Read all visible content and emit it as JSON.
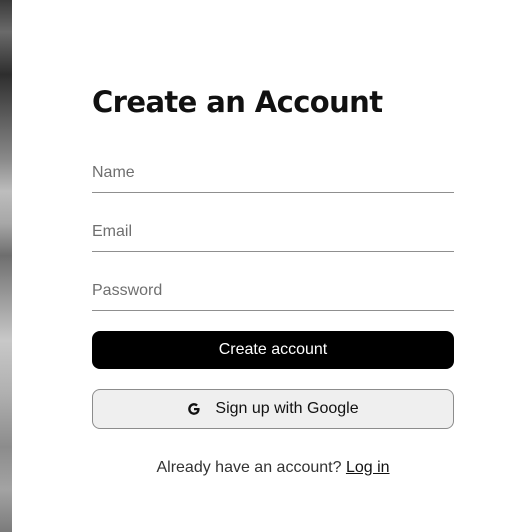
{
  "form": {
    "title": "Create an Account",
    "name_placeholder": "Name",
    "email_placeholder": "Email",
    "password_placeholder": "Password",
    "create_label": "Create account",
    "google_label": "Sign up with Google",
    "google_icon": "google-g-icon",
    "login_prompt": "Already have an account?",
    "login_link": "Log in"
  },
  "colors": {
    "primary_button": "#000000",
    "google_button_bg": "#efefef",
    "text": "#111111"
  }
}
